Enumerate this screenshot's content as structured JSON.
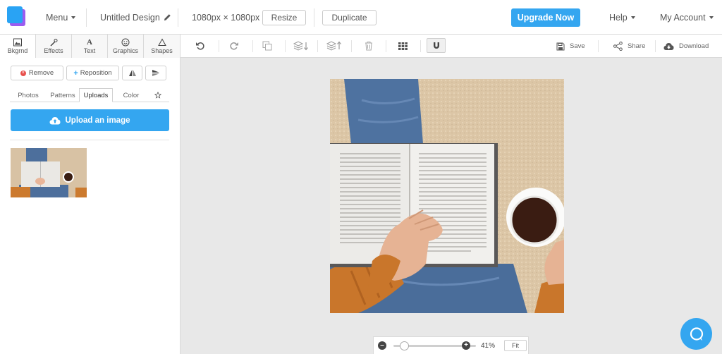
{
  "header": {
    "menu_label": "Menu",
    "design_title": "Untitled Design",
    "dimensions": "1080px × 1080px",
    "resize_label": "Resize",
    "duplicate_label": "Duplicate",
    "upgrade_label": "Upgrade Now",
    "help_label": "Help",
    "account_label": "My Account"
  },
  "left_tabs": [
    {
      "label": "Bkgrnd",
      "icon": "image-icon"
    },
    {
      "label": "Effects",
      "icon": "wand-icon"
    },
    {
      "label": "Text",
      "icon": "text-icon"
    },
    {
      "label": "Graphics",
      "icon": "smiley-icon"
    },
    {
      "label": "Shapes",
      "icon": "triangle-icon"
    }
  ],
  "bg_actions": {
    "remove_label": "Remove",
    "reposition_label": "Reposition"
  },
  "sub_tabs": [
    "Photos",
    "Patterns",
    "Uploads",
    "Color"
  ],
  "active_sub_tab": "Uploads",
  "upload_label": "Upload an image",
  "toolbar": {
    "save_label": "Save",
    "share_label": "Share",
    "download_label": "Download"
  },
  "zoom": {
    "percent_label": "41%",
    "value": 0.41,
    "fit_label": "Fit"
  },
  "colors": {
    "accent": "#34a6f0",
    "logo_blue": "#29a3f4",
    "logo_purple": "#9b5cf0"
  }
}
